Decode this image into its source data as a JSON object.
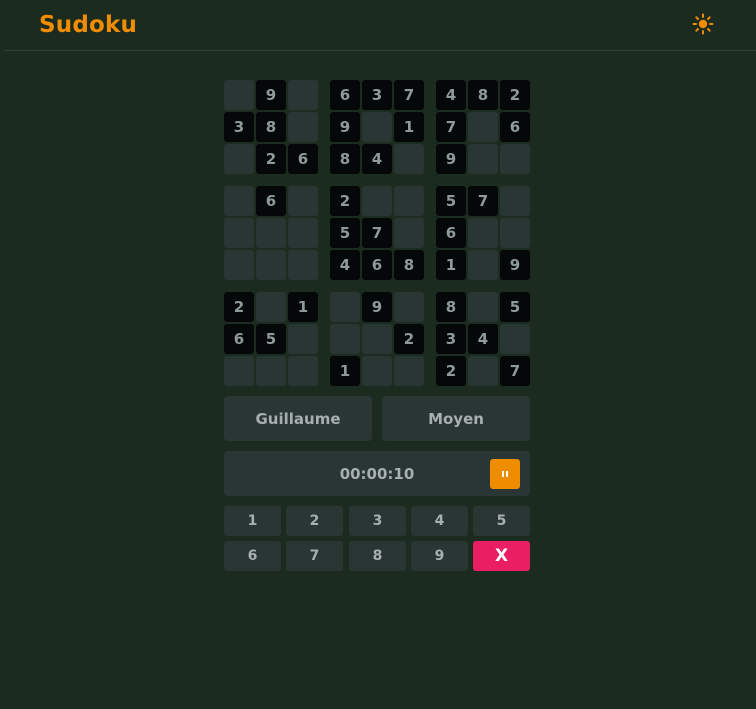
{
  "header": {
    "title": "Sudoku",
    "theme_icon": "sun-icon",
    "accent_color": "#f08c00"
  },
  "board": {
    "rows": [
      [
        "",
        "9",
        "",
        "6",
        "3",
        "7",
        "4",
        "8",
        "2"
      ],
      [
        "3",
        "8",
        "",
        "9",
        "",
        "1",
        "7",
        "",
        "6"
      ],
      [
        "",
        "2",
        "6",
        "8",
        "4",
        "",
        "9",
        "",
        ""
      ],
      [
        "",
        "6",
        "",
        "2",
        "",
        "",
        "5",
        "7",
        ""
      ],
      [
        "",
        "",
        "",
        "5",
        "7",
        "",
        "6",
        "",
        ""
      ],
      [
        "",
        "",
        "",
        "4",
        "6",
        "8",
        "1",
        "",
        "9"
      ],
      [
        "2",
        "",
        "1",
        "",
        "9",
        "",
        "8",
        "",
        "5"
      ],
      [
        "6",
        "5",
        "",
        "",
        "",
        "2",
        "3",
        "4",
        ""
      ],
      [
        "",
        "",
        "",
        "1",
        "",
        "",
        "2",
        "",
        "7"
      ]
    ]
  },
  "player": {
    "name": "Guillaume",
    "difficulty": "Moyen"
  },
  "timer": {
    "value": "00:00:10",
    "pause_icon": "pause-icon"
  },
  "numpad": {
    "keys": [
      "1",
      "2",
      "3",
      "4",
      "5",
      "6",
      "7",
      "8",
      "9"
    ],
    "erase_label": "X",
    "erase_color": "#e91e63"
  }
}
